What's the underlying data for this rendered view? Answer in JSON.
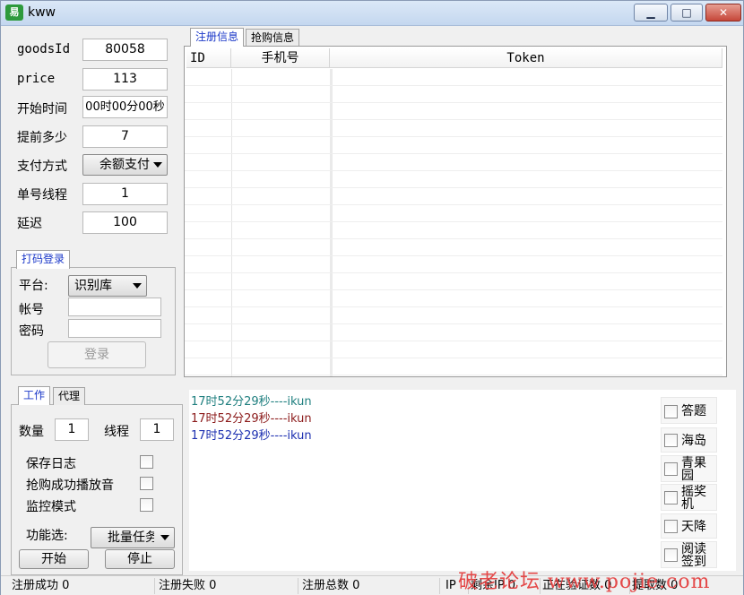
{
  "window": {
    "title": "kww",
    "icon": "易",
    "controls": {
      "minimize": "▁",
      "maximize": "□",
      "close": "✕"
    }
  },
  "form": {
    "goods_id": {
      "label": "goodsId",
      "value": "80058"
    },
    "price": {
      "label": "price",
      "value": "113"
    },
    "start_time": {
      "label": "开始时间",
      "value": "00时00分00秒"
    },
    "advance": {
      "label": "提前多少",
      "value": "7"
    },
    "payment": {
      "label": "支付方式",
      "value": "余额支付"
    },
    "threads_per_order": {
      "label": "单号线程",
      "value": "1"
    },
    "delay": {
      "label": "延迟",
      "value": "100"
    }
  },
  "captcha_login": {
    "tab": "打码登录",
    "platform_label": "平台:",
    "platform_value": "识别库",
    "account_label": "帐号",
    "account_value": "",
    "password_label": "密码",
    "password_value": "",
    "login_button": "登录"
  },
  "work": {
    "tabs": [
      "工作",
      "代理"
    ],
    "quantity_label": "数量",
    "quantity_value": "1",
    "threads_label": "线程",
    "threads_value": "1",
    "options": [
      "保存日志",
      "抢购成功播放音",
      "监控模式"
    ],
    "function_label": "功能选:",
    "function_value": "批量任务",
    "start_button": "开始",
    "stop_button": "停止"
  },
  "register_table": {
    "tabs": [
      "注册信息",
      "抢购信息"
    ],
    "columns": [
      "ID",
      "手机号",
      "Token"
    ]
  },
  "log": [
    {
      "text": "17时52分29秒----ikun",
      "color": "#1f7f7f"
    },
    {
      "text": "17时52分29秒----ikun",
      "color": "#8b1a1a"
    },
    {
      "text": "17时52分29秒----ikun",
      "color": "#1c2fb0"
    }
  ],
  "right_options": [
    "答题",
    "海岛",
    "青果园",
    "摇奖机",
    "天降",
    "阅读签到"
  ],
  "status": {
    "reg_success": "注册成功 0",
    "reg_fail": "注册失败 0",
    "reg_total": "注册总数 0",
    "ip": "IP",
    "remain_ip": "剩余IP 0",
    "verifying": "正在验证数 0",
    "extract": "提取数 0"
  },
  "watermark": "破老论坛  www.pojie.com"
}
